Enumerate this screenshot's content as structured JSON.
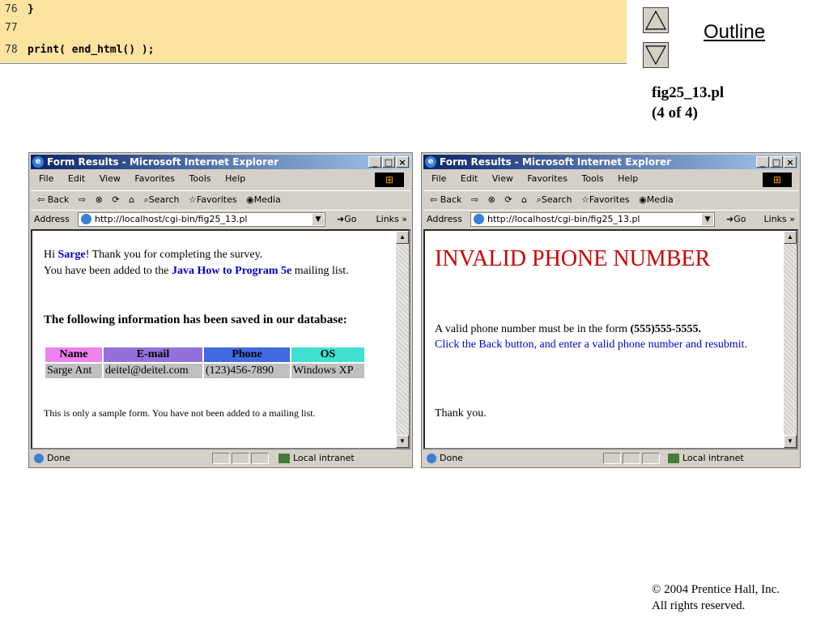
{
  "code": [
    {
      "num": "76",
      "text": "}"
    },
    {
      "num": "77",
      "text": ""
    },
    {
      "num": "78",
      "text": "print( end_html() );"
    }
  ],
  "nav": {
    "outline": "Outline",
    "caption_line1": "fig25_13.pl",
    "caption_line2": "(4 of 4)"
  },
  "browser": {
    "title": "Form Results - Microsoft Internet Explorer",
    "menu": [
      "File",
      "Edit",
      "View",
      "Favorites",
      "Tools",
      "Help"
    ],
    "toolbar": {
      "back": "⇦ Back",
      "fwd": "⇨",
      "search": "Search",
      "favorites": "Favorites",
      "media": "Media"
    },
    "address_label": "Address",
    "address": "http://localhost/cgi-bin/fig25_13.pl",
    "go": "Go",
    "links": "Links »",
    "status": "Done",
    "zone": "Local intranet"
  },
  "left_page": {
    "hi": "Hi ",
    "name": "Sarge",
    "thanks": "! Thank you for completing the survey.",
    "added_pre": "You have been added to the ",
    "book": "Java How to Program 5e",
    "added_post": " mailing list.",
    "heading": "The following information has been saved in our database:",
    "table_headers": [
      "Name",
      "E-mail",
      "Phone",
      "OS"
    ],
    "header_colors": [
      "#ee82ee",
      "#9370db",
      "#4169e1",
      "#40e0d0"
    ],
    "table_row": [
      "Sarge Ant",
      "deitel@deitel.com",
      "(123)456-7890",
      "Windows XP"
    ],
    "note": "This is only a sample form. You have not been added to a mailing list."
  },
  "right_page": {
    "invalid": "INVALID PHONE NUMBER",
    "form_pre": "A valid phone number must be in the form ",
    "form_example": "(555)555-5555.",
    "instructions": "Click the Back button, and enter a valid phone number and resubmit.",
    "thanks": "Thank you."
  },
  "copyright": {
    "line1": "© 2004 Prentice Hall, Inc.",
    "line2": "All rights reserved."
  }
}
